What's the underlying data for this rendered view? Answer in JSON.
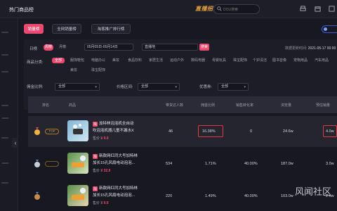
{
  "topbar": {
    "title": "热门商品榜",
    "brand": "直播招商",
    "search_placeholder": "DOU搜索"
  },
  "tabs": [
    {
      "label": "销量榜",
      "active": true
    },
    {
      "label": "全网销量榜",
      "active": false
    },
    {
      "label": "淘客推广排行榜",
      "active": false
    }
  ],
  "filters": {
    "period_label": "日榜",
    "period_options": [
      "日榜",
      "周榜",
      "月榜"
    ],
    "date_range": "05月05日-05月14日",
    "keyword_value": "直播地",
    "search_button": "搜索",
    "update_label": "数据更新时间:",
    "update_time": "2021-05-17 00:00",
    "category_label": "商品分类:",
    "categories": [
      "全部",
      "服饰鞋包",
      "电脑办公",
      "美妆",
      "食品饮料",
      "家居生活",
      "运动户外",
      "数码电器",
      "母婴玩具",
      "珠宝配饰",
      "个护清洁",
      "图书音像",
      "宠物用品",
      "汽车用品"
    ],
    "active_category": "全部",
    "platform_label": "商品来源:",
    "platform_value": "全部",
    "price_label": "价格区间:",
    "price_value": "全部",
    "coupon_label": "优惠券:",
    "coupon_value": "全部",
    "promo_label": "佣金比例:",
    "promo_value": "全部"
  },
  "table": {
    "headers": [
      "排名",
      "商品",
      "带货达人数",
      "佣金比例",
      "销售转化率",
      "浏览量",
      "预估销量"
    ],
    "rows": [
      {
        "rank_badge": "TOP",
        "product_name_line1": "加特林泡泡机全自动",
        "product_name_line2": "吹泡泡机器儿童不漏水X",
        "price_label": "售价",
        "price": "¥ 9.9",
        "talent_count": "46",
        "commission": "16.38%",
        "conversion": "0",
        "views": "24.6w",
        "sales": "4.0w",
        "highlight": true
      },
      {
        "rank_badge": "",
        "product_name_line1": "新款网红同大号加特林",
        "product_name_line2": "加长15孔风扇电动泡泡...",
        "price_label": "售价",
        "price": "¥ 32.9",
        "talent_count": "534",
        "commission": "1.71%",
        "conversion": "40.00%",
        "views": "187.0w",
        "sales": "3.0w",
        "highlight": false
      },
      {
        "rank_badge": "",
        "product_name_line1": "新款网红同大号加特林",
        "product_name_line2": "加长15孔风扇电动泡泡...",
        "price_label": "售价",
        "price": "¥ 9.9",
        "talent_count": "220",
        "commission": "1.49%",
        "conversion": "40.00%",
        "views": "103.0w",
        "sales": "2.6w",
        "highlight": false
      }
    ]
  },
  "watermark": "风闻社区",
  "colors": {
    "accent": "#e8496c",
    "highlight_box": "#e03a3a",
    "brand": "#e8a23a"
  }
}
